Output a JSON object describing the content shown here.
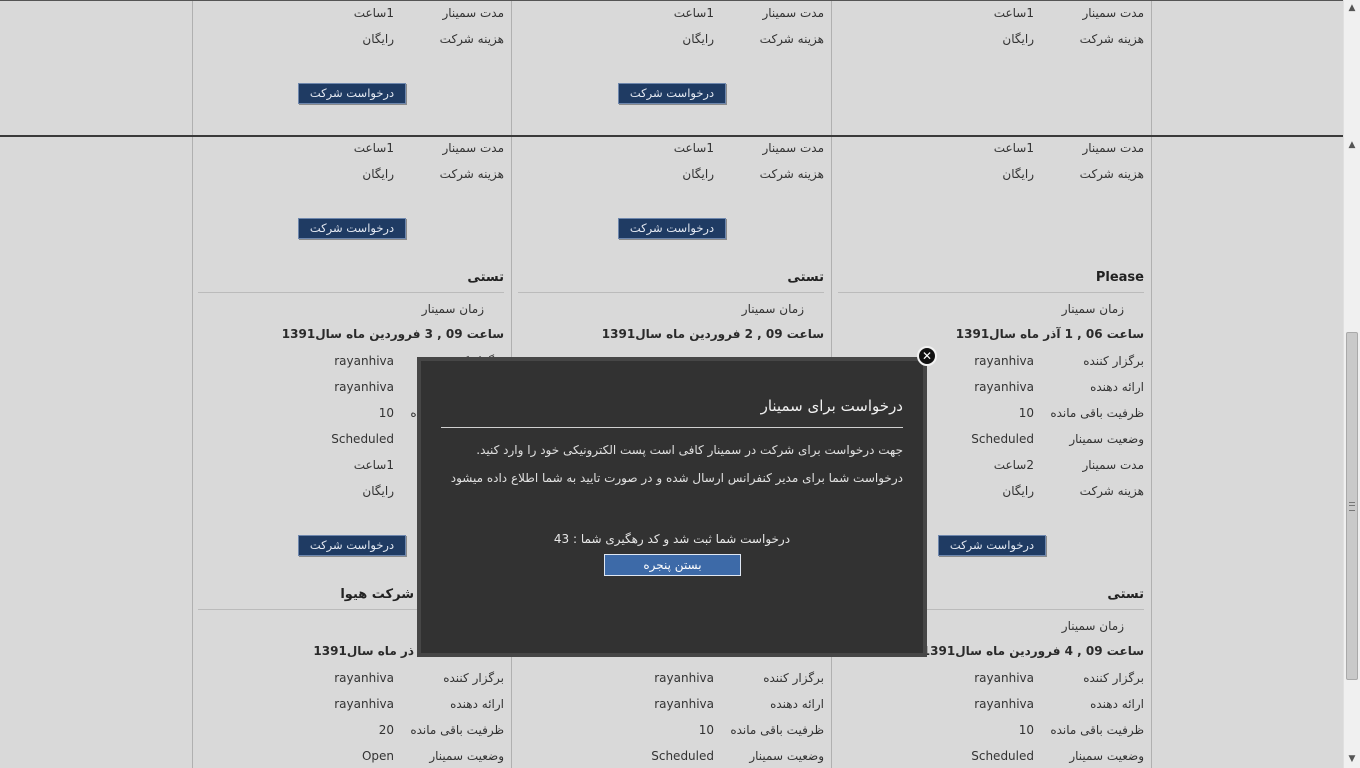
{
  "labels": {
    "duration": "مدت سمینار",
    "cost": "هزینه شرکت",
    "time": "زمان سمینار",
    "organizer": "برگزار کننده",
    "presenter": "ارائه دهنده",
    "capacity": "ظرفیت باقی مانده",
    "status": "وضعیت سمینار",
    "request_button": "درخواست شرکت"
  },
  "top_frame": {
    "cards": [
      {
        "duration": "1ساعت",
        "cost": "رایگان"
      },
      {
        "duration": "1ساعت",
        "cost": "رایگان"
      },
      {
        "duration": "1ساعت",
        "cost": "رایگان"
      }
    ]
  },
  "main_frame": {
    "row1": [
      {
        "duration": "1ساعت",
        "cost": "رایگان"
      },
      {
        "duration": "1ساعت",
        "cost": "رایگان"
      },
      {
        "duration": "1ساعت",
        "cost": "رایگان"
      }
    ],
    "row2": [
      {
        "title": "Please",
        "date": "ساعت 06 , 1 آذر ماه سال1391",
        "organizer": "rayanhiva",
        "presenter": "rayanhiva",
        "capacity": "10",
        "status": "Scheduled",
        "duration": "2ساعت",
        "cost": "رایگان"
      },
      {
        "title": "تستی",
        "date": "ساعت 09 , 2 فروردین ماه سال1391"
      },
      {
        "title": "تستی",
        "date": "ساعت 09 , 3 فروردین ماه سال1391",
        "organizer": "rayanhiva",
        "presenter": "rayanhiva",
        "capacity": "10",
        "status": "Scheduled",
        "duration": "1ساعت",
        "cost": "رایگان"
      }
    ],
    "row3": [
      {
        "title": "تستی",
        "date": "ساعت 09 , 4 فروردین ماه سال1391",
        "organizer": "rayanhiva",
        "presenter": "rayanhiva",
        "capacity": "10",
        "status": "Scheduled"
      },
      {
        "organizer": "rayanhiva",
        "presenter": "rayanhiva",
        "capacity": "10",
        "status": "Scheduled"
      },
      {
        "title": "شرکت هیوا",
        "date": "ذر ماه سال1391",
        "organizer": "rayanhiva",
        "presenter": "rayanhiva",
        "capacity": "20",
        "status": "Open"
      }
    ]
  },
  "modal": {
    "title": "درخواست برای سمینار",
    "line1": "جهت درخواست برای شرکت در سمینار کافی است پست الکترونیکی خود را وارد کنید.",
    "line2": "درخواست شما برای مدیر کنفرانس ارسال شده و در صورت تایید به شما اطلاع داده میشود",
    "result": "درخواست شما ثبت شد و کد رهگیری شما : 43",
    "close_button": "بستن پنجره",
    "close_icon": "✕"
  },
  "scrollbar": {
    "up_icon": "▲",
    "down_icon": "▼"
  }
}
